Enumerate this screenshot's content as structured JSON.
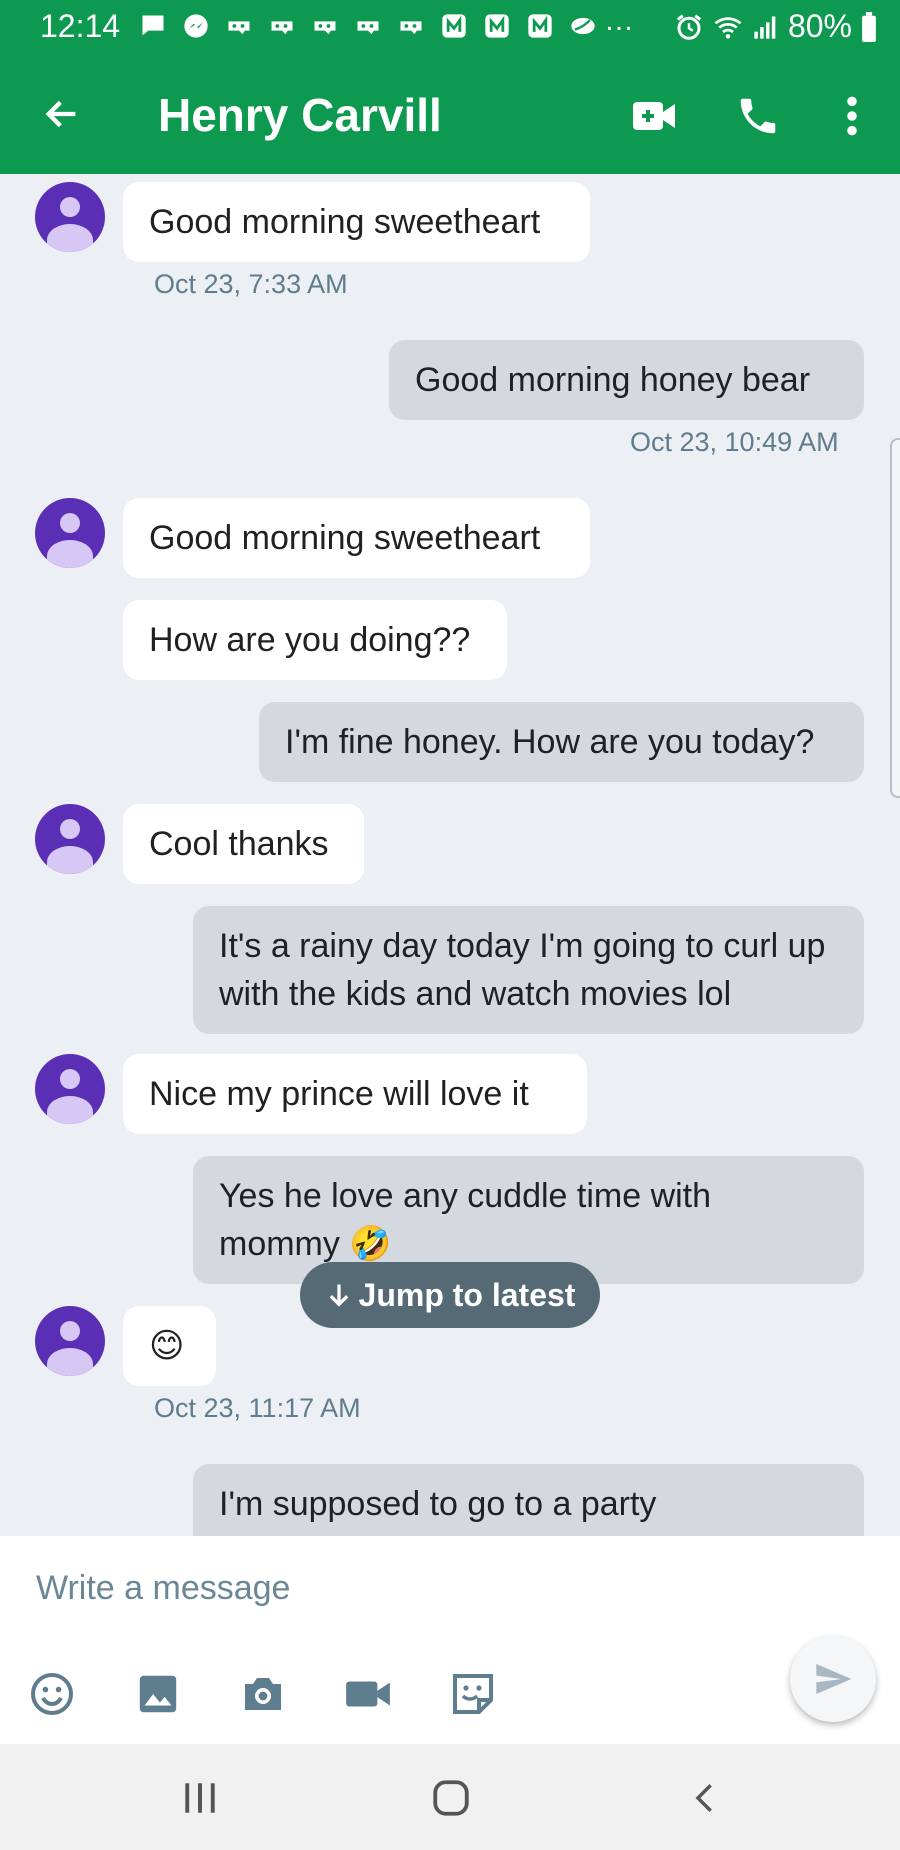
{
  "status_bar": {
    "time": "12:14",
    "battery": "80%",
    "overflow": "…",
    "notification_icons": [
      "chat-icon",
      "messenger-icon",
      "game-icon",
      "game-icon",
      "game-icon",
      "game-icon",
      "game-icon",
      "square-n-icon",
      "square-n-icon",
      "square-n-icon",
      "leaf-icon"
    ],
    "status_icons": [
      "alarm-icon",
      "wifi-icon",
      "signal-icon",
      "battery-icon"
    ]
  },
  "app_bar": {
    "title": "Henry Carvill",
    "color": "#0d9a50",
    "icons": [
      "back-arrow-icon",
      "video-call-icon",
      "phone-icon",
      "more-vert-icon"
    ]
  },
  "messages": [
    {
      "direction": "incoming",
      "text": "Good morning sweetheart",
      "timestamp": "Oct 23, 7:33 AM"
    },
    {
      "direction": "outgoing",
      "text": "Good morning honey bear",
      "timestamp": "Oct 23, 10:49 AM"
    },
    {
      "direction": "incoming",
      "text": "Good morning sweetheart"
    },
    {
      "direction": "incoming",
      "text": "How are you doing??"
    },
    {
      "direction": "outgoing",
      "text": "I'm fine honey. How are you today?"
    },
    {
      "direction": "incoming",
      "text": "Cool thanks"
    },
    {
      "direction": "outgoing",
      "text": "It's a rainy day today I'm going to curl up with the kids and watch movies lol"
    },
    {
      "direction": "incoming",
      "text": "Nice my prince will love it"
    },
    {
      "direction": "outgoing",
      "text": "Yes he love any cuddle time with mommy 🤣"
    },
    {
      "direction": "incoming",
      "text": "😊",
      "timestamp": "Oct 23, 11:17 AM"
    },
    {
      "direction": "outgoing",
      "text": "I'm supposed to go to a party"
    }
  ],
  "jump_to_latest": {
    "label": "Jump to latest",
    "icon": "arrow-down-icon"
  },
  "composer": {
    "placeholder": "Write a message",
    "value": "",
    "attach_icons": [
      "emoji-icon",
      "gallery-icon",
      "camera-icon",
      "video-icon",
      "sticker-icon"
    ],
    "send_icon": "send-icon"
  },
  "nav_bar": {
    "icons": [
      "recents-icon",
      "home-icon",
      "back-icon"
    ]
  },
  "colors": {
    "incoming_bubble": "#ffffff",
    "outgoing_bubble": "#d3d9de",
    "avatar": "#5b2fb5",
    "timestamp": "#5f7d8c"
  }
}
